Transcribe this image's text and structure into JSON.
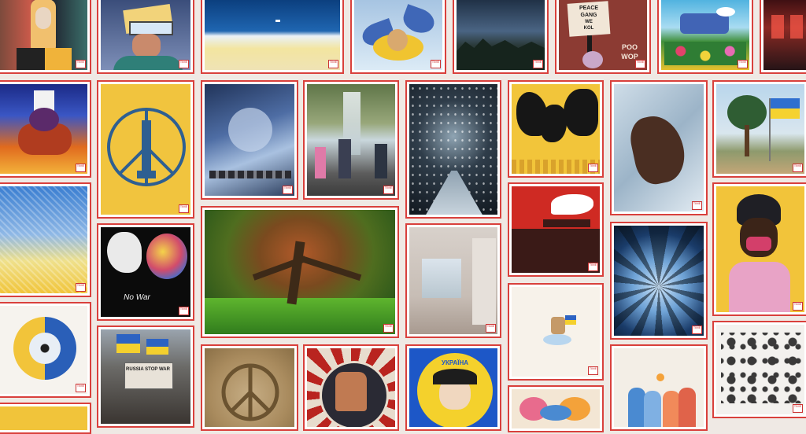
{
  "badge_text": "TIME",
  "artworks": {
    "peace_gang": [
      "PEACE",
      "GANG",
      "WE",
      "KOL",
      "POO",
      "WOP"
    ],
    "no_war": "No War",
    "protest_sign": "RUSSIA STOP WAR",
    "angel_banner": "УКРАЇНА"
  }
}
